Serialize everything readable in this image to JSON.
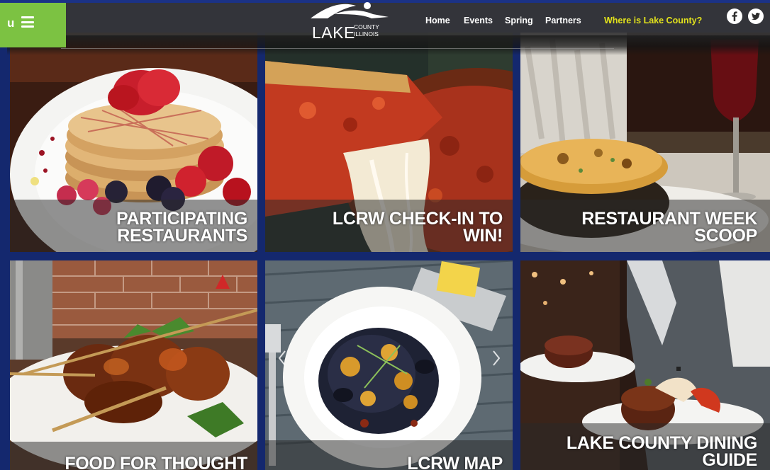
{
  "header": {
    "menu_label": "u",
    "logo": {
      "lake": "LAKE",
      "county": "COUNTY",
      "state": "ILLINOIS"
    },
    "nav": [
      {
        "label": "Home"
      },
      {
        "label": "Events"
      },
      {
        "label": "Spring"
      },
      {
        "label": "Partners"
      },
      {
        "label": "Where is Lake County?"
      }
    ],
    "social": [
      "facebook-icon",
      "twitter-icon"
    ]
  },
  "tiles": [
    {
      "id": "participating-restaurants",
      "lines": [
        "PARTICIPATING",
        "RESTAURANTS"
      ]
    },
    {
      "id": "lcrw-check-in",
      "lines": [
        "LCRW CHECK-IN TO",
        "WIN!"
      ]
    },
    {
      "id": "restaurant-week-scoop",
      "lines": [
        "RESTAURANT WEEK",
        "SCOOP"
      ]
    },
    {
      "id": "food-for-thought",
      "lines": [
        "FOOD FOR THOUGHT"
      ]
    },
    {
      "id": "lcrw-map",
      "lines": [
        "LCRW MAP"
      ]
    },
    {
      "id": "dining-guide",
      "lines": [
        "LAKE COUNTY DINING",
        "GUIDE"
      ]
    }
  ],
  "colors": {
    "page_bg": "#14286e",
    "menu_green": "#7cc242",
    "highlight_nav": "#e2e21c"
  }
}
